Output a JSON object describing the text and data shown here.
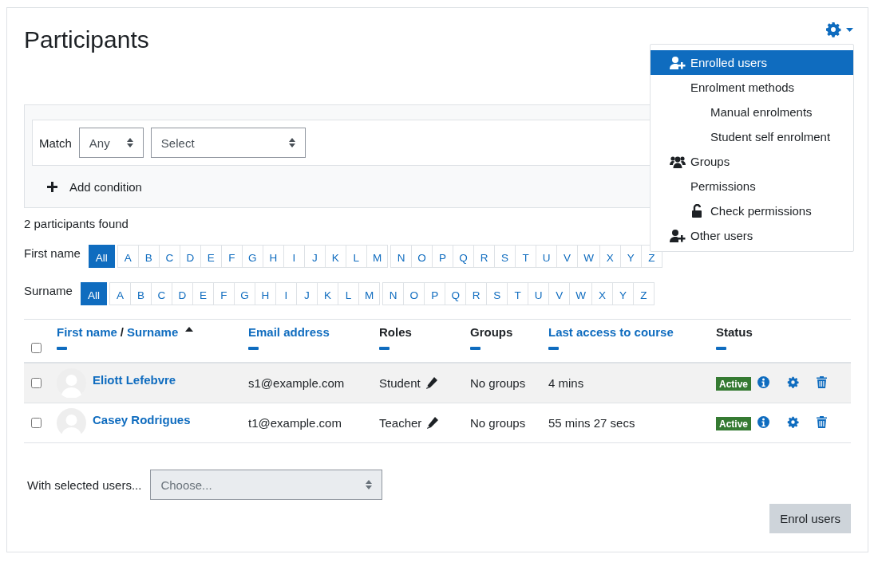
{
  "page": {
    "title": "Participants"
  },
  "settings_menu": {
    "expanded": true,
    "items": [
      {
        "label": "Enrolled users",
        "kind": "adduser",
        "selected": true
      },
      {
        "label": "Enrolment methods",
        "kind": "plain",
        "selected": false,
        "children": [
          {
            "label": "Manual enrolments",
            "kind": "plain",
            "selected": false
          },
          {
            "label": "Student self enrolment",
            "kind": "plain",
            "selected": false
          }
        ]
      },
      {
        "label": "Groups",
        "kind": "groups",
        "selected": false
      },
      {
        "label": "Permissions",
        "kind": "plain",
        "selected": false,
        "children": [
          {
            "label": "Check permissions",
            "kind": "lock",
            "selected": false
          }
        ]
      },
      {
        "label": "Other users",
        "kind": "adduser",
        "selected": false
      }
    ]
  },
  "filter": {
    "match_label": "Match",
    "match_value": "Any",
    "condition_value": "Select",
    "add_button": "Add condition"
  },
  "result_count": "2 participants found",
  "initials_bars": [
    {
      "label": "First name",
      "groups": [
        [
          {
            "label": "All",
            "selected": true
          },
          {
            "label": "A",
            "selected": false
          },
          {
            "label": "B",
            "selected": false
          },
          {
            "label": "C",
            "selected": false
          },
          {
            "label": "D",
            "selected": false
          },
          {
            "label": "E",
            "selected": false
          },
          {
            "label": "F",
            "selected": false
          },
          {
            "label": "G",
            "selected": false
          },
          {
            "label": "H",
            "selected": false
          },
          {
            "label": "I",
            "selected": false
          },
          {
            "label": "J",
            "selected": false
          },
          {
            "label": "K",
            "selected": false
          },
          {
            "label": "L",
            "selected": false
          },
          {
            "label": "M",
            "selected": false
          }
        ],
        [
          {
            "label": "N",
            "selected": false
          },
          {
            "label": "O",
            "selected": false
          },
          {
            "label": "P",
            "selected": false
          },
          {
            "label": "Q",
            "selected": false
          },
          {
            "label": "R",
            "selected": false
          },
          {
            "label": "S",
            "selected": false
          },
          {
            "label": "T",
            "selected": false
          },
          {
            "label": "U",
            "selected": false
          },
          {
            "label": "V",
            "selected": false
          },
          {
            "label": "W",
            "selected": false
          },
          {
            "label": "X",
            "selected": false
          },
          {
            "label": "Y",
            "selected": false
          },
          {
            "label": "Z",
            "selected": false
          }
        ]
      ]
    },
    {
      "label": "Surname",
      "groups": [
        [
          {
            "label": "All",
            "selected": true
          },
          {
            "label": "A",
            "selected": false
          },
          {
            "label": "B",
            "selected": false
          },
          {
            "label": "C",
            "selected": false
          },
          {
            "label": "D",
            "selected": false
          },
          {
            "label": "E",
            "selected": false
          },
          {
            "label": "F",
            "selected": false
          },
          {
            "label": "G",
            "selected": false
          },
          {
            "label": "H",
            "selected": false
          },
          {
            "label": "I",
            "selected": false
          },
          {
            "label": "J",
            "selected": false
          },
          {
            "label": "K",
            "selected": false
          },
          {
            "label": "L",
            "selected": false
          },
          {
            "label": "M",
            "selected": false
          }
        ],
        [
          {
            "label": "N",
            "selected": false
          },
          {
            "label": "O",
            "selected": false
          },
          {
            "label": "P",
            "selected": false
          },
          {
            "label": "Q",
            "selected": false
          },
          {
            "label": "R",
            "selected": false
          },
          {
            "label": "S",
            "selected": false
          },
          {
            "label": "T",
            "selected": false
          },
          {
            "label": "U",
            "selected": false
          },
          {
            "label": "V",
            "selected": false
          },
          {
            "label": "W",
            "selected": false
          },
          {
            "label": "X",
            "selected": false
          },
          {
            "label": "Y",
            "selected": false
          },
          {
            "label": "Z",
            "selected": false
          }
        ]
      ]
    }
  ],
  "table": {
    "select_all": {
      "checked": false
    },
    "columns": [
      {
        "kind": "name",
        "links": [
          "First name",
          "Surname"
        ],
        "separator": "/",
        "sorted": true
      },
      {
        "kind": "link",
        "label": "Email address",
        "sorted": false
      },
      {
        "kind": "plain",
        "label": "Roles",
        "sorted": false
      },
      {
        "kind": "plain",
        "label": "Groups",
        "sorted": false
      },
      {
        "kind": "link",
        "label": "Last access to course",
        "sorted": false
      },
      {
        "kind": "plain",
        "label": "Status",
        "sorted": false
      }
    ],
    "rows": [
      {
        "checked": false,
        "highlighted": true,
        "name": "Eliott Lefebvre",
        "email": "s1@example.com",
        "role": "Student",
        "groups": "No groups",
        "last_access": "4 mins",
        "status": "Active"
      },
      {
        "checked": false,
        "highlighted": false,
        "name": "Casey Rodrigues",
        "email": "t1@example.com",
        "role": "Teacher",
        "groups": "No groups",
        "last_access": "55 mins 27 secs",
        "status": "Active"
      }
    ]
  },
  "bulk": {
    "label": "With selected users...",
    "select": {
      "placeholder": "Choose...",
      "disabled": true
    }
  },
  "enrol_button": "Enrol users"
}
